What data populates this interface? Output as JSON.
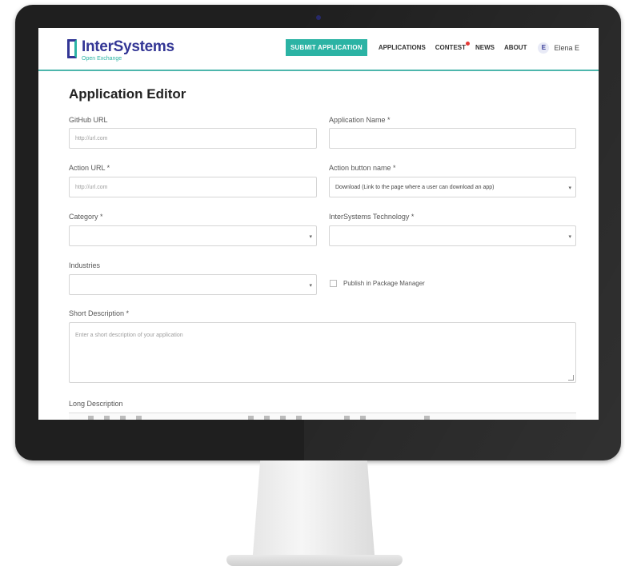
{
  "header": {
    "logo_title": "InterSystems",
    "logo_subtitle": "Open Exchange",
    "submit_label": "SUBMIT APPLICATION",
    "nav": [
      "APPLICATIONS",
      "CONTEST",
      "NEWS",
      "ABOUT"
    ],
    "avatar_initial": "E",
    "user_name": "Elena E"
  },
  "page": {
    "title": "Application Editor"
  },
  "form": {
    "github_url": {
      "label": "GitHub URL",
      "placeholder": "http://url.com"
    },
    "app_name": {
      "label": "Application Name *",
      "value": ""
    },
    "action_url": {
      "label": "Action URL *",
      "placeholder": "http://url.com"
    },
    "action_button_name": {
      "label": "Action button name *",
      "value": "Download (Link to the page where a user can download an app)"
    },
    "category": {
      "label": "Category *",
      "value": ""
    },
    "technology": {
      "label": "InterSystems Technology *",
      "value": ""
    },
    "industries": {
      "label": "Industries",
      "value": ""
    },
    "publish": {
      "label": "Publish in Package Manager",
      "checked": false
    },
    "short_description": {
      "label": "Short Description *",
      "placeholder": "Enter a short description of your application"
    },
    "long_description": {
      "label": "Long Description"
    }
  },
  "colors": {
    "brand": "#333695",
    "accent": "#2bb3a4",
    "notification": "#e53935"
  }
}
